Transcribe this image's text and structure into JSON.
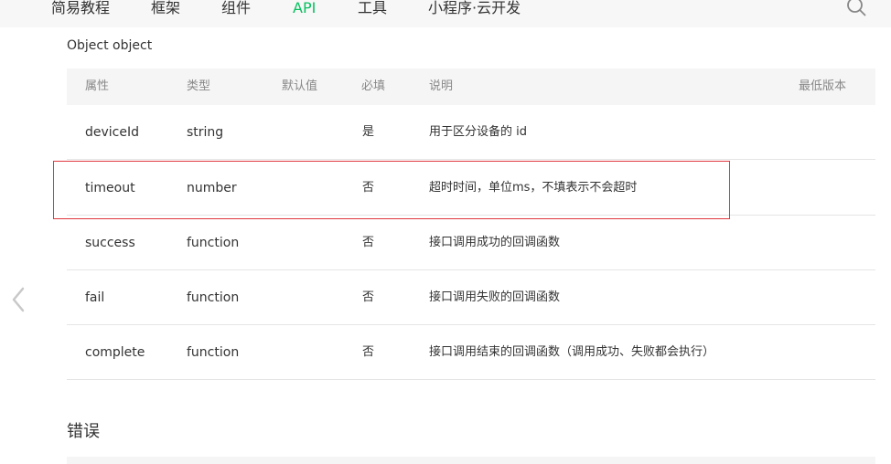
{
  "nav": {
    "items": [
      "简易教程",
      "框架",
      "组件",
      "API",
      "工具",
      "小程序·云开发"
    ],
    "active_index": 3,
    "active_color": "#07c160"
  },
  "icons": {
    "search": "search-icon",
    "back": "chevron-left-icon"
  },
  "object_title": "Object object",
  "table": {
    "headers": {
      "property": "属性",
      "type": "类型",
      "default": "默认值",
      "required": "必填",
      "description": "说明",
      "min_version": "最低版本"
    },
    "rows": [
      {
        "property": "deviceId",
        "type": "string",
        "default": "",
        "required": "是",
        "description": "用于区分设备的 id",
        "min_version": ""
      },
      {
        "property": "timeout",
        "type": "number",
        "default": "",
        "required": "否",
        "description": "超时时间，单位ms，不填表示不会超时",
        "min_version": ""
      },
      {
        "property": "success",
        "type": "function",
        "default": "",
        "required": "否",
        "description": "接口调用成功的回调函数",
        "min_version": ""
      },
      {
        "property": "fail",
        "type": "function",
        "default": "",
        "required": "否",
        "description": "接口调用失败的回调函数",
        "min_version": ""
      },
      {
        "property": "complete",
        "type": "function",
        "default": "",
        "required": "否",
        "description": "接口调用结束的回调函数（调用成功、失败都会执行）",
        "min_version": ""
      }
    ],
    "highlighted_row_index": 1,
    "highlight_color": "#e0393e"
  },
  "errors_section": {
    "title": "错误"
  }
}
